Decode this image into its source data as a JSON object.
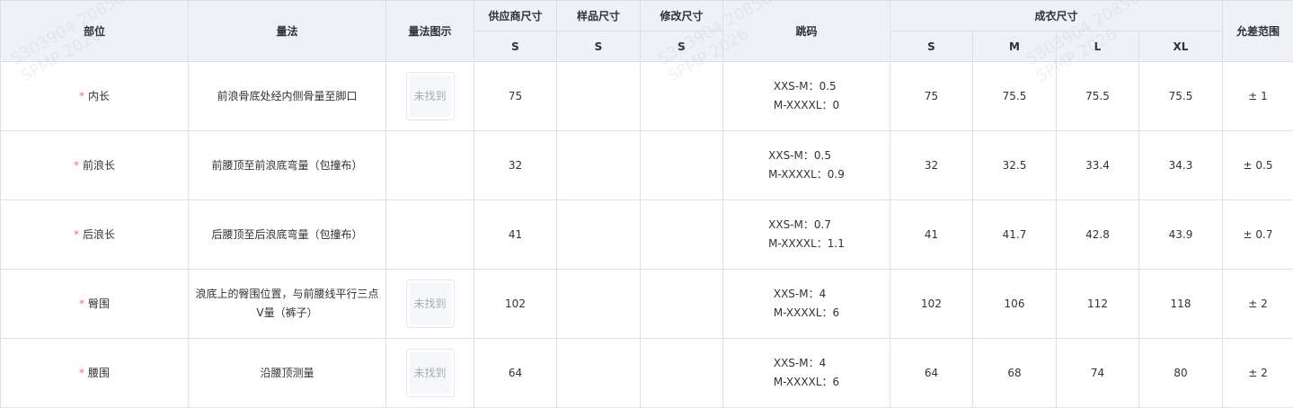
{
  "table": {
    "headers": {
      "part": "部位",
      "method": "量法",
      "diagram": "量法图示",
      "supplier_size": "供应商尺寸",
      "sample_size": "样品尺寸",
      "revised_size": "修改尺寸",
      "grading": "跳码",
      "finished_size": "成衣尺寸",
      "tolerance": "允差范围"
    },
    "sub_headers": {
      "supplier": "S",
      "sample": "S",
      "revised": "S",
      "finished": [
        "S",
        "M",
        "L",
        "XL"
      ]
    },
    "required_mark": "*",
    "rows": [
      {
        "part": "内长",
        "method": "前浪骨底处经内侧骨量至脚口",
        "diagram": "未找到",
        "supplier": "75",
        "sample": "",
        "revised": "",
        "grading_1": "XXS-M：0.5",
        "grading_2": "M-XXXXL：0",
        "s": "75",
        "m": "75.5",
        "l": "75.5",
        "xl": "75.5",
        "tolerance": "± 1"
      },
      {
        "part": "前浪长",
        "method": "前腰顶至前浪底弯量（包撞布）",
        "diagram": "",
        "supplier": "32",
        "sample": "",
        "revised": "",
        "grading_1": "XXS-M：0.5",
        "grading_2": "M-XXXXL：0.9",
        "s": "32",
        "m": "32.5",
        "l": "33.4",
        "xl": "34.3",
        "tolerance": "± 0.5"
      },
      {
        "part": "后浪长",
        "method": "后腰顶至后浪底弯量（包撞布）",
        "diagram": "",
        "supplier": "41",
        "sample": "",
        "revised": "",
        "grading_1": "XXS-M：0.7",
        "grading_2": "M-XXXXL：1.1",
        "s": "41",
        "m": "41.7",
        "l": "42.8",
        "xl": "43.9",
        "tolerance": "± 0.7"
      },
      {
        "part": "臀围",
        "method": "浪底上的臀围位置，与前腰线平行三点V量（裤子）",
        "diagram": "未找到",
        "supplier": "102",
        "sample": "",
        "revised": "",
        "grading_1": "XXS-M：4",
        "grading_2": "M-XXXXL：6",
        "s": "102",
        "m": "106",
        "l": "112",
        "xl": "118",
        "tolerance": "± 2"
      },
      {
        "part": "腰围",
        "method": "沿腰顶测量",
        "diagram": "未找到",
        "supplier": "64",
        "sample": "",
        "revised": "",
        "grading_1": "XXS-M：4",
        "grading_2": "M-XXXXL：6",
        "s": "64",
        "m": "68",
        "l": "74",
        "xl": "80",
        "tolerance": "± 2"
      }
    ]
  },
  "watermark": {
    "line_1": "5303904 20850",
    "line_2": "SPMP 2026"
  }
}
